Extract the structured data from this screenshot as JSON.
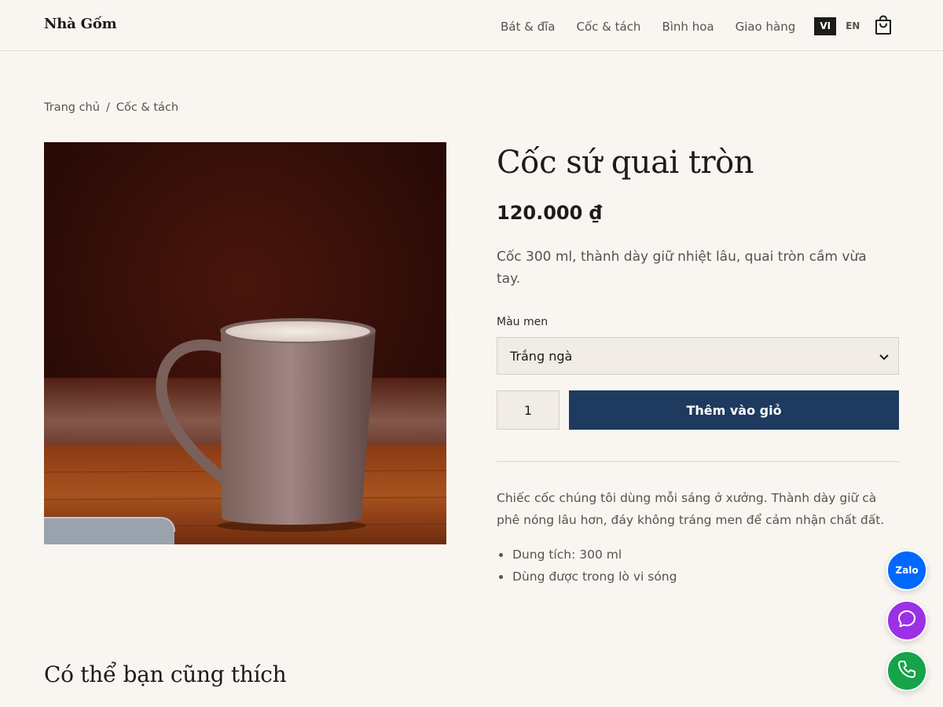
{
  "header": {
    "brand": "Nhà Gốm",
    "nav": [
      "Bát & đĩa",
      "Cốc & tách",
      "Bình hoa",
      "Giao hàng"
    ],
    "lang_active": "VI",
    "lang_other": "EN",
    "cart_icon": "shopping-bag-icon"
  },
  "breadcrumb": {
    "home": "Trang chủ",
    "separator": "/",
    "current": "Cốc & tách"
  },
  "product": {
    "title": "Cốc sứ quai tròn",
    "price": "120.000 ₫",
    "short_description": "Cốc 300 ml, thành dày giữ nhiệt lâu, quai tròn cầm vừa tay.",
    "glaze_label": "Màu men",
    "glaze_selected": "Trắng ngà",
    "quantity": "1",
    "add_to_cart": "Thêm vào giỏ",
    "long_description": "Chiếc cốc chúng tôi dùng mỗi sáng ở xưởng. Thành dày giữ cà phê nóng lâu hơn, đáy không tráng men để cảm nhận chất đất.",
    "features": [
      "Dung tích: 300 ml",
      "Dùng được trong lò vi sóng"
    ]
  },
  "related": {
    "heading": "Có thể bạn cũng thích"
  },
  "floating": {
    "zalo_label": "Zalo",
    "chat_icon": "chat-bubble-icon",
    "phone_icon": "phone-icon"
  },
  "colors": {
    "accent": "#1e3a5f",
    "background": "#f9f6f2",
    "zalo": "#0068ff",
    "chat": "#9b30e6",
    "phone": "#16a34a"
  }
}
